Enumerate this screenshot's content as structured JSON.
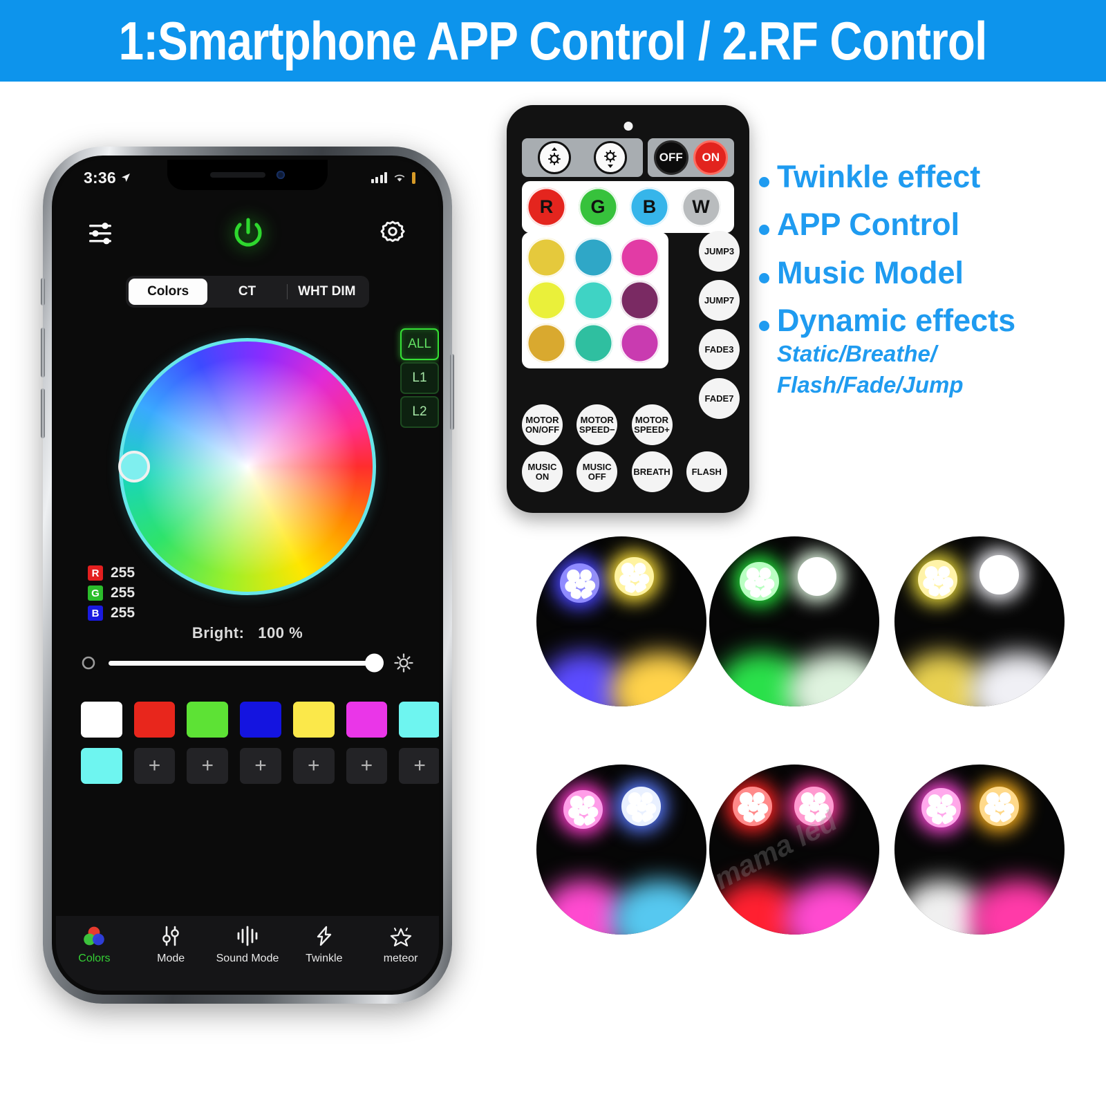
{
  "banner": {
    "title": "1:Smartphone APP Control / 2.RF Control"
  },
  "phone": {
    "status": {
      "time": "3:36",
      "location_icon": "location-arrow-icon",
      "signal_icon": "signal-bars-icon",
      "wifi_icon": "wifi-icon",
      "battery_icon": "battery-icon"
    },
    "header": {
      "sliders_icon": "sliders-icon",
      "power_icon": "power-icon",
      "settings_icon": "gear-icon"
    },
    "tabs": [
      {
        "label": "Colors",
        "active": true
      },
      {
        "label": "CT",
        "active": false
      },
      {
        "label": "WHT DIM",
        "active": false
      }
    ],
    "zones": [
      {
        "label": "ALL",
        "active": true
      },
      {
        "label": "L1",
        "active": false
      },
      {
        "label": "L2",
        "active": false
      }
    ],
    "color_wheel": {
      "handle_color": "#7fefef",
      "ring_color": "#67e6ea"
    },
    "rgb": [
      {
        "channel": "R",
        "value": "255",
        "chip_color": "#e41f1f"
      },
      {
        "channel": "G",
        "value": "255",
        "chip_color": "#2bbd2b"
      },
      {
        "channel": "B",
        "value": "255",
        "chip_color": "#1a1ae0"
      }
    ],
    "brightness": {
      "label": "Bright:",
      "value": "100 %",
      "percent": 100,
      "min_icon": "circle-icon",
      "max_icon": "sun-icon"
    },
    "swatches_row1": [
      "#ffffff",
      "#e8261c",
      "#5de235",
      "#1414e0",
      "#fbe84a",
      "#ea36e8",
      "#6ef5f0"
    ],
    "swatches_row2_first": "#6ef5f0",
    "add_label": "+",
    "add_count": 6,
    "bottom_nav": [
      {
        "label": "Colors",
        "icon": "color-circles-icon",
        "active": true
      },
      {
        "label": "Mode",
        "icon": "sliders-vertical-icon",
        "active": false
      },
      {
        "label": "Sound Mode",
        "icon": "waveform-icon",
        "active": false
      },
      {
        "label": "Twinkle",
        "icon": "lightning-icon",
        "active": false
      },
      {
        "label": "meteor",
        "icon": "star-sparkle-icon",
        "active": false
      }
    ]
  },
  "remote": {
    "led_indicator": "ir-led-indicator",
    "dim_buttons": [
      {
        "label": "",
        "icon": "brightness-up-icon"
      },
      {
        "label": "",
        "icon": "brightness-down-icon"
      }
    ],
    "power_buttons": [
      {
        "label": "OFF",
        "color": "#0c0c0c"
      },
      {
        "label": "ON",
        "color": "#e2241e"
      }
    ],
    "rgbw": [
      {
        "label": "R",
        "color": "#e4251e"
      },
      {
        "label": "G",
        "color": "#37c23c"
      },
      {
        "label": "B",
        "color": "#36b5ea"
      },
      {
        "label": "W",
        "color": "#b9bcbe"
      }
    ],
    "color_rows": [
      [
        "#e5c93c",
        "#2fa7c7",
        "#e23ba5"
      ],
      [
        "#eaf03a",
        "#3fd3c4",
        "#7a2a63"
      ],
      [
        "#d9a92f",
        "#2fbfa0",
        "#c93bb0"
      ]
    ],
    "side_buttons": [
      "JUMP3",
      "JUMP7",
      "FADE3",
      "FADE7"
    ],
    "bottom_buttons": [
      "MOTOR ON/OFF",
      "MOTOR SPEED−",
      "MOTOR SPEED+",
      "MUSIC ON",
      "MUSIC OFF",
      "BREATH",
      "FLASH"
    ]
  },
  "features": {
    "bullets": [
      "Twinkle effect",
      "APP Control",
      "Music Model",
      "Dynamic effects"
    ],
    "subnote_line1": "Static/Breathe/",
    "subnote_line2": "Flash/Fade/Jump",
    "accent_color": "#1f9bf0"
  },
  "led_photos": [
    {
      "name": "blue-yellow-led",
      "left_color": "#4a46ff",
      "right_color": "#ffe23a",
      "floor_left": "#5b4bff",
      "floor_right": "#ffd24a"
    },
    {
      "name": "green-white-led",
      "left_color": "#26e03c",
      "right_color": "#ffffff",
      "floor_left": "#2ae04a",
      "floor_right": "#e8f3e8"
    },
    {
      "name": "yellowgreen-white-led",
      "left_color": "#f2e23a",
      "right_color": "#ffffff",
      "floor_left": "#e8d050",
      "floor_right": "#f0f0f5"
    },
    {
      "name": "magenta-blue-led",
      "left_color": "#ff3ccd",
      "right_color": "#5a7bff",
      "floor_left": "#ff4ad0",
      "floor_right": "#56c8f0"
    },
    {
      "name": "red-pink-led",
      "left_color": "#ff2424",
      "right_color": "#ff3ca0",
      "floor_left": "#ff2030",
      "floor_right": "#ff4ad0"
    },
    {
      "name": "pink-orange-led",
      "left_color": "#ff49d9",
      "right_color": "#ffb41e",
      "floor_left": "#f0f0f0",
      "floor_right": "#ff3aa8"
    }
  ],
  "watermark": {
    "text": "kimama led"
  }
}
